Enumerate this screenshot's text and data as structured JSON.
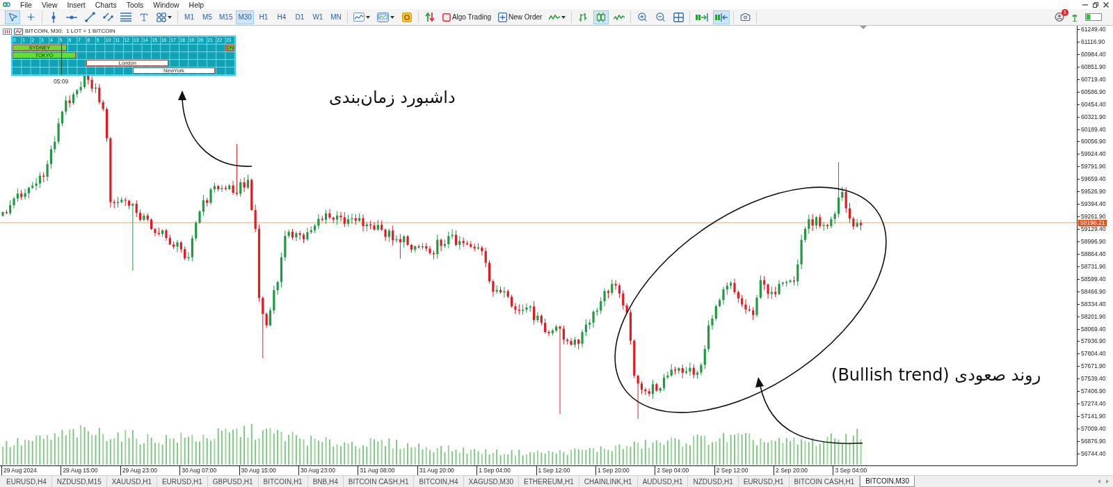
{
  "menu": {
    "items": [
      "File",
      "View",
      "Insert",
      "Charts",
      "Tools",
      "Window",
      "Help"
    ]
  },
  "toolbar": {
    "groups": [
      {
        "items": [
          {
            "kind": "cursor",
            "selected": true,
            "dropdown": false
          },
          {
            "kind": "crosshair",
            "selected": false,
            "dropdown": false
          }
        ]
      },
      {
        "items": [
          {
            "kind": "vertical-line",
            "selected": false,
            "dropdown": false
          },
          {
            "kind": "horizontal-line",
            "selected": false,
            "dropdown": false
          },
          {
            "kind": "trend-line",
            "selected": false,
            "dropdown": false
          },
          {
            "kind": "channel",
            "selected": false,
            "dropdown": false
          },
          {
            "kind": "levels",
            "selected": false,
            "dropdown": false
          },
          {
            "kind": "text",
            "selected": false,
            "dropdown": false
          },
          {
            "kind": "shapes",
            "selected": false,
            "dropdown": true
          }
        ]
      },
      {
        "items": [
          {
            "kind": "timeframe",
            "label": "M1",
            "selected": false,
            "dropdown": false
          },
          {
            "kind": "timeframe",
            "label": "M5",
            "selected": false,
            "dropdown": false
          },
          {
            "kind": "timeframe",
            "label": "M15",
            "selected": false,
            "dropdown": false
          },
          {
            "kind": "timeframe",
            "label": "M30",
            "selected": true,
            "dropdown": false
          },
          {
            "kind": "timeframe",
            "label": "H1",
            "selected": false,
            "dropdown": false
          },
          {
            "kind": "timeframe",
            "label": "H4",
            "selected": false,
            "dropdown": false
          },
          {
            "kind": "timeframe",
            "label": "D1",
            "selected": false,
            "dropdown": false
          },
          {
            "kind": "timeframe",
            "label": "W1",
            "selected": false,
            "dropdown": false
          },
          {
            "kind": "timeframe",
            "label": "MN",
            "selected": false,
            "dropdown": false
          }
        ]
      },
      {
        "items": [
          {
            "kind": "chart-type",
            "selected": false,
            "dropdown": true
          },
          {
            "kind": "template",
            "selected": false,
            "dropdown": true
          },
          {
            "kind": "market",
            "selected": false,
            "dropdown": false
          }
        ]
      },
      {
        "items": [
          {
            "kind": "trade",
            "selected": false,
            "dropdown": false
          },
          {
            "kind": "algo-trading",
            "label": "Algo Trading",
            "selected": false,
            "dropdown": false
          },
          {
            "kind": "new-order",
            "label": "New Order",
            "selected": false,
            "dropdown": false
          },
          {
            "kind": "indicators",
            "selected": false,
            "dropdown": true
          }
        ]
      },
      {
        "items": [
          {
            "kind": "bars",
            "selected": false,
            "dropdown": false
          },
          {
            "kind": "candles",
            "selected": true,
            "dropdown": false
          },
          {
            "kind": "line",
            "selected": false,
            "dropdown": false
          }
        ]
      },
      {
        "items": [
          {
            "kind": "zoom-in",
            "selected": false,
            "dropdown": false
          },
          {
            "kind": "zoom-out",
            "selected": false,
            "dropdown": false
          },
          {
            "kind": "tile",
            "selected": false,
            "dropdown": false
          }
        ]
      },
      {
        "items": [
          {
            "kind": "autoscroll",
            "selected": false,
            "dropdown": false
          },
          {
            "kind": "shift",
            "selected": true,
            "dropdown": false
          }
        ]
      },
      {
        "items": [
          {
            "kind": "screenshot",
            "selected": false,
            "dropdown": false
          }
        ]
      }
    ],
    "notification_count": "1"
  },
  "chart": {
    "symbol_line": "BITCOIN, M30:  1 LOT = 1 BITCOIN",
    "dashboard": {
      "hours": [
        "0",
        "1",
        "2",
        "3",
        "4",
        "5",
        "6",
        "7",
        "8",
        "9",
        "10",
        "11",
        "12",
        "13",
        "14",
        "15",
        "16",
        "17",
        "18",
        "19",
        "20",
        "21",
        "22",
        "23"
      ],
      "rows": [
        {
          "sessions": [
            {
              "label": "SYDNEY",
              "color": "#66dd33"
            },
            {
              "label": "DN",
              "color": "#66dd33"
            }
          ]
        },
        {
          "sessions": [
            {
              "label": "TOKYO",
              "color": "#66dd33"
            }
          ]
        },
        {
          "sessions": [
            {
              "label": "London",
              "color": "#ffffff"
            }
          ]
        },
        {
          "sessions": [
            {
              "label": "NewYork",
              "color": "#ffffff"
            }
          ]
        }
      ],
      "time_marker": {
        "label": "05:09",
        "level": 0.22
      }
    },
    "annotations": [
      {
        "text": "داشبورد زمان‌بندی"
      },
      {
        "text": "روند صعودی (Bullish trend)"
      }
    ],
    "current_price": "59198.21",
    "price_axis": [
      "61249.40",
      "61116.90",
      "60984.40",
      "60851.90",
      "60719.40",
      "60586.90",
      "60454.40",
      "60321.90",
      "60189.40",
      "60056.90",
      "59924.40",
      "59791.90",
      "59659.40",
      "59526.90",
      "59394.40",
      "59261.90",
      "59129.40",
      "58996.90",
      "58864.40",
      "58731.90",
      "58599.40",
      "58466.90",
      "58334.40",
      "58201.90",
      "58069.40",
      "57936.90",
      "57804.40",
      "57671.90",
      "57539.40",
      "57406.90",
      "57274.40",
      "57141.90",
      "57009.40",
      "56876.90",
      "56744.40"
    ],
    "time_axis": [
      "29 Aug 2024",
      "29 Aug 15:00",
      "29 Aug 23:00",
      "30 Aug 07:00",
      "30 Aug 15:00",
      "30 Aug 23:00",
      "31 Aug 08:00",
      "31 Aug 20:00",
      "1 Sep 04:00",
      "1 Sep 12:00",
      "1 Sep 20:00",
      "2 Sep 04:00",
      "2 Sep 12:00",
      "2 Sep 20:00",
      "3 Sep 04:00"
    ]
  },
  "tabs": [
    {
      "label": "EURUSD,H4",
      "selected": false
    },
    {
      "label": "NZDUSD,M15",
      "selected": false
    },
    {
      "label": "XAUUSD,H1",
      "selected": false
    },
    {
      "label": "EURUSD,H1",
      "selected": false
    },
    {
      "label": "GBPUSD,H1",
      "selected": false
    },
    {
      "label": "BITCOIN,H1",
      "selected": false
    },
    {
      "label": "BNB,H4",
      "selected": false
    },
    {
      "label": "BITCOIN CASH,H1",
      "selected": false
    },
    {
      "label": "BITCOIN,H4",
      "selected": false
    },
    {
      "label": "XAGUSD,M30",
      "selected": false
    },
    {
      "label": "ETHEREUM,H1",
      "selected": false
    },
    {
      "label": "CHAINLINK,H1",
      "selected": false
    },
    {
      "label": "AUDUSD,H1",
      "selected": false
    },
    {
      "label": "NZDUSD,H1",
      "selected": false
    },
    {
      "label": "EURUSD,H1",
      "selected": false
    },
    {
      "label": "BITCOIN CASH,H1",
      "selected": false
    },
    {
      "label": "BITCOIN,M30",
      "selected": true
    }
  ]
}
